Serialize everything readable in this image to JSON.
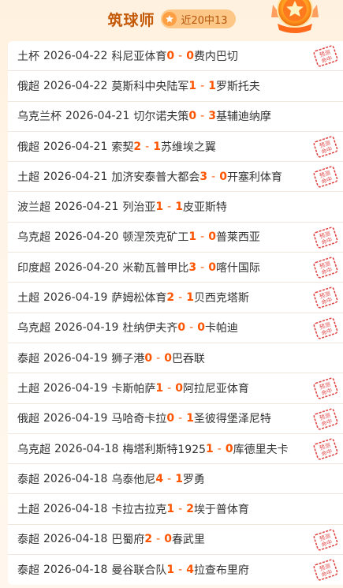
{
  "header": {
    "title": "筑球师",
    "badge_text": "近20中13",
    "icons": [
      "star-icon",
      "medal-icon"
    ]
  },
  "stamp_text": [
    "预测",
    "命中"
  ],
  "colors": {
    "accent": "#ff5500",
    "title": "#c45a08",
    "stamp": "#e04848"
  },
  "matches": [
    {
      "league": "土杯",
      "date": "2026-04-22",
      "home": "科尼亚体育",
      "home_score": "0",
      "away_score": "0",
      "away": "费内巴切",
      "hit": true
    },
    {
      "league": "俄超",
      "date": "2026-04-22",
      "home": "莫斯科中央陆军",
      "home_score": "1",
      "away_score": "1",
      "away": "罗斯托夫",
      "hit": false
    },
    {
      "league": "乌克兰杯",
      "date": "2026-04-21",
      "home": "切尔诺夫策",
      "home_score": "0",
      "away_score": "3",
      "away": "基辅迪纳摩",
      "hit": false
    },
    {
      "league": "俄超",
      "date": "2026-04-21",
      "home": "索契",
      "home_score": "2",
      "away_score": "1",
      "away": "苏维埃之翼",
      "hit": true
    },
    {
      "league": "土超",
      "date": "2026-04-21",
      "home": "加济安泰普大都会",
      "home_score": "3",
      "away_score": "0",
      "away": "开塞利体育",
      "hit": true
    },
    {
      "league": "波兰超",
      "date": "2026-04-21",
      "home": "列治亚",
      "home_score": "1",
      "away_score": "1",
      "away": "皮亚斯特",
      "hit": false
    },
    {
      "league": "乌克超",
      "date": "2026-04-20",
      "home": "顿涅茨克矿工",
      "home_score": "1",
      "away_score": "0",
      "away": "普莱西亚",
      "hit": true
    },
    {
      "league": "印度超",
      "date": "2026-04-20",
      "home": "米勒瓦普甲比",
      "home_score": "3",
      "away_score": "0",
      "away": "喀什国际",
      "hit": true
    },
    {
      "league": "土超",
      "date": "2026-04-19",
      "home": "萨姆松体育",
      "home_score": "2",
      "away_score": "1",
      "away": "贝西克塔斯",
      "hit": true
    },
    {
      "league": "乌克超",
      "date": "2026-04-19",
      "home": "杜纳伊夫齐",
      "home_score": "0",
      "away_score": "0",
      "away": "卡帕迪",
      "hit": true
    },
    {
      "league": "泰超",
      "date": "2026-04-19",
      "home": "狮子港",
      "home_score": "0",
      "away_score": "0",
      "away": "巴吞联",
      "hit": false
    },
    {
      "league": "土超",
      "date": "2026-04-19",
      "home": "卡斯帕萨",
      "home_score": "1",
      "away_score": "0",
      "away": "阿拉尼亚体育",
      "hit": true
    },
    {
      "league": "俄超",
      "date": "2026-04-19",
      "home": "马哈奇卡拉",
      "home_score": "0",
      "away_score": "1",
      "away": "圣彼得堡泽尼特",
      "hit": true
    },
    {
      "league": "乌克超",
      "date": "2026-04-18",
      "home": "梅塔利斯特1925",
      "home_score": "1",
      "away_score": "0",
      "away": "库德里夫卡",
      "hit": true
    },
    {
      "league": "泰超",
      "date": "2026-04-18",
      "home": "乌泰他尼",
      "home_score": "4",
      "away_score": "1",
      "away": "罗勇",
      "hit": false
    },
    {
      "league": "土超",
      "date": "2026-04-18",
      "home": "卡拉古拉克",
      "home_score": "1",
      "away_score": "2",
      "away": "埃于普体育",
      "hit": false
    },
    {
      "league": "泰超",
      "date": "2026-04-18",
      "home": "巴蜀府",
      "home_score": "2",
      "away_score": "0",
      "away": "春武里",
      "hit": true
    },
    {
      "league": "泰超",
      "date": "2026-04-18",
      "home": "曼谷联合队",
      "home_score": "1",
      "away_score": "4",
      "away": "拉查布里府",
      "hit": true
    }
  ]
}
